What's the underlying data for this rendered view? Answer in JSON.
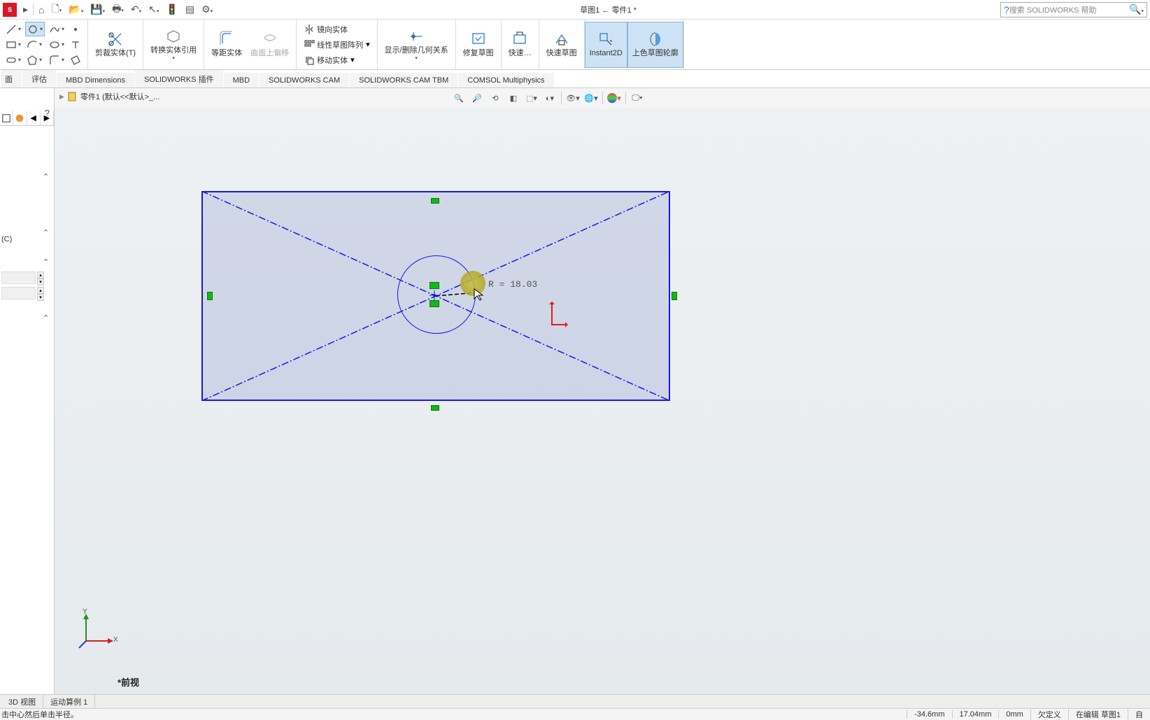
{
  "title_center": "草图1 ← 零件1 *",
  "search": {
    "placeholder": "搜索 SOLIDWORKS 帮助"
  },
  "ribbon": {
    "trim": "剪裁实体(T)",
    "convert": "转换实体引用",
    "offset": "等距实体",
    "onsurf": "曲面上偏移",
    "mirror": "镜向实体",
    "linpattern": "线性草图阵列",
    "move": "移动实体",
    "display_rel": "显示/删除几何关系",
    "repair": "修复草图",
    "rapid": "快速…",
    "rapid_sketch": "快速草图",
    "instant2d": "Instant2D",
    "shaded": "上色草图轮廓"
  },
  "tabs": {
    "t0": "面",
    "t1": "评估",
    "t2": "MBD Dimensions",
    "t3": "SOLIDWORKS 插件",
    "t4": "MBD",
    "t5": "SOLIDWORKS CAM",
    "t6": "SOLIDWORKS CAM TBM",
    "t7": "COMSOL Multiphysics"
  },
  "breadcrumb": "零件1 (默认<<默认>_...",
  "fm": {
    "section_c": "(C)"
  },
  "sketch": {
    "radius_label": "R = 18.03",
    "view_name": "*前视"
  },
  "triad_labels": {
    "x": "X",
    "y": "Y"
  },
  "bottom_tabs": {
    "view3d": "3D 视图",
    "motion": "运动算例 1"
  },
  "status": {
    "prompt": "击中心然后单击半径。",
    "x": "-34.6mm",
    "y": "17.04mm",
    "z": "0mm",
    "def": "欠定义",
    "edit": "在编辑 草图1",
    "right": "自"
  }
}
